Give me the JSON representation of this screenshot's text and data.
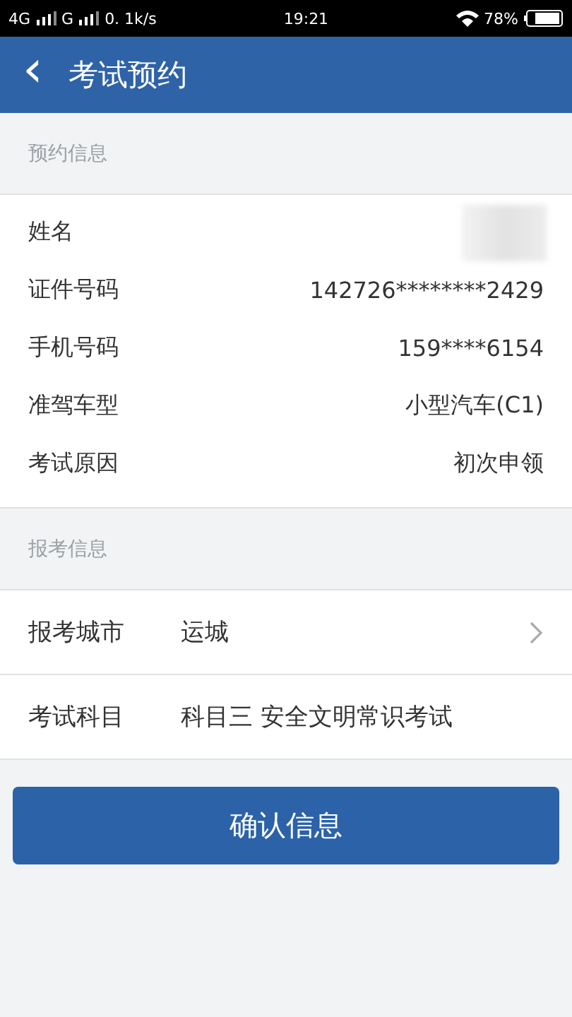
{
  "status_bar": {
    "network_1": "4G",
    "network_2": "G",
    "speed": "0. 1k/s",
    "time": "19:21",
    "battery": "78%"
  },
  "header": {
    "back": "‹",
    "title": "考试预约"
  },
  "sections": [
    {
      "title": "预约信息",
      "kind": "info",
      "rows": [
        {
          "kind": "redacted",
          "label": "姓名"
        },
        {
          "kind": "text",
          "label": "证件号码",
          "value": "142726********2429"
        },
        {
          "kind": "text",
          "label": "手机号码",
          "value": "159****6154"
        },
        {
          "kind": "text",
          "label": "准驾车型",
          "value": "小型汽车(C1)"
        },
        {
          "kind": "text",
          "label": "考试原因",
          "value": "初次申领"
        }
      ]
    },
    {
      "title": "报考信息",
      "kind": "form",
      "rows": [
        {
          "kind": "link",
          "label": "报考城市",
          "value": "运城"
        },
        {
          "kind": "text",
          "label": "考试科目",
          "value": "科目三 安全文明常识考试"
        }
      ]
    }
  ],
  "confirm_button": "确认信息"
}
